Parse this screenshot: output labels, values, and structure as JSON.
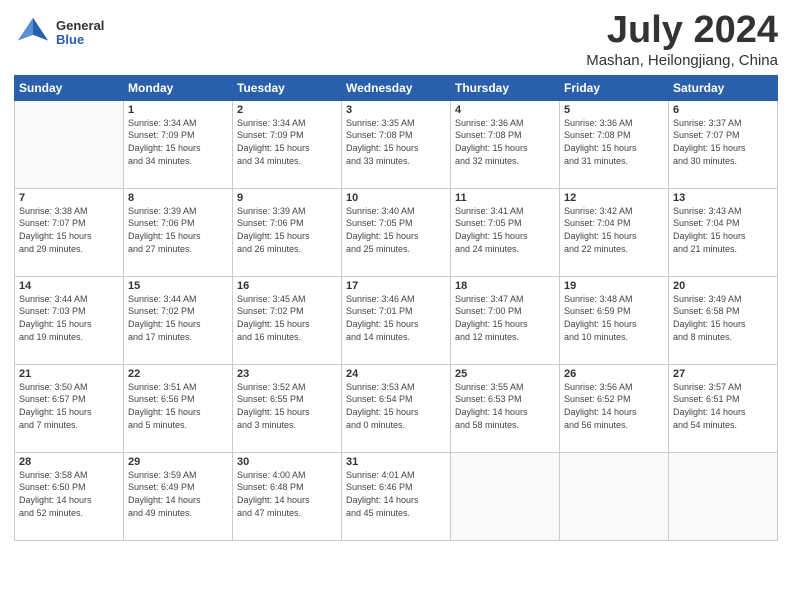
{
  "logo": {
    "general": "General",
    "blue": "Blue"
  },
  "title": "July 2024",
  "location": "Mashan, Heilongjiang, China",
  "days_of_week": [
    "Sunday",
    "Monday",
    "Tuesday",
    "Wednesday",
    "Thursday",
    "Friday",
    "Saturday"
  ],
  "weeks": [
    [
      {
        "day": "",
        "info": ""
      },
      {
        "day": "1",
        "info": "Sunrise: 3:34 AM\nSunset: 7:09 PM\nDaylight: 15 hours\nand 34 minutes."
      },
      {
        "day": "2",
        "info": "Sunrise: 3:34 AM\nSunset: 7:09 PM\nDaylight: 15 hours\nand 34 minutes."
      },
      {
        "day": "3",
        "info": "Sunrise: 3:35 AM\nSunset: 7:08 PM\nDaylight: 15 hours\nand 33 minutes."
      },
      {
        "day": "4",
        "info": "Sunrise: 3:36 AM\nSunset: 7:08 PM\nDaylight: 15 hours\nand 32 minutes."
      },
      {
        "day": "5",
        "info": "Sunrise: 3:36 AM\nSunset: 7:08 PM\nDaylight: 15 hours\nand 31 minutes."
      },
      {
        "day": "6",
        "info": "Sunrise: 3:37 AM\nSunset: 7:07 PM\nDaylight: 15 hours\nand 30 minutes."
      }
    ],
    [
      {
        "day": "7",
        "info": "Sunrise: 3:38 AM\nSunset: 7:07 PM\nDaylight: 15 hours\nand 29 minutes."
      },
      {
        "day": "8",
        "info": "Sunrise: 3:39 AM\nSunset: 7:06 PM\nDaylight: 15 hours\nand 27 minutes."
      },
      {
        "day": "9",
        "info": "Sunrise: 3:39 AM\nSunset: 7:06 PM\nDaylight: 15 hours\nand 26 minutes."
      },
      {
        "day": "10",
        "info": "Sunrise: 3:40 AM\nSunset: 7:05 PM\nDaylight: 15 hours\nand 25 minutes."
      },
      {
        "day": "11",
        "info": "Sunrise: 3:41 AM\nSunset: 7:05 PM\nDaylight: 15 hours\nand 24 minutes."
      },
      {
        "day": "12",
        "info": "Sunrise: 3:42 AM\nSunset: 7:04 PM\nDaylight: 15 hours\nand 22 minutes."
      },
      {
        "day": "13",
        "info": "Sunrise: 3:43 AM\nSunset: 7:04 PM\nDaylight: 15 hours\nand 21 minutes."
      }
    ],
    [
      {
        "day": "14",
        "info": "Sunrise: 3:44 AM\nSunset: 7:03 PM\nDaylight: 15 hours\nand 19 minutes."
      },
      {
        "day": "15",
        "info": "Sunrise: 3:44 AM\nSunset: 7:02 PM\nDaylight: 15 hours\nand 17 minutes."
      },
      {
        "day": "16",
        "info": "Sunrise: 3:45 AM\nSunset: 7:02 PM\nDaylight: 15 hours\nand 16 minutes."
      },
      {
        "day": "17",
        "info": "Sunrise: 3:46 AM\nSunset: 7:01 PM\nDaylight: 15 hours\nand 14 minutes."
      },
      {
        "day": "18",
        "info": "Sunrise: 3:47 AM\nSunset: 7:00 PM\nDaylight: 15 hours\nand 12 minutes."
      },
      {
        "day": "19",
        "info": "Sunrise: 3:48 AM\nSunset: 6:59 PM\nDaylight: 15 hours\nand 10 minutes."
      },
      {
        "day": "20",
        "info": "Sunrise: 3:49 AM\nSunset: 6:58 PM\nDaylight: 15 hours\nand 8 minutes."
      }
    ],
    [
      {
        "day": "21",
        "info": "Sunrise: 3:50 AM\nSunset: 6:57 PM\nDaylight: 15 hours\nand 7 minutes."
      },
      {
        "day": "22",
        "info": "Sunrise: 3:51 AM\nSunset: 6:56 PM\nDaylight: 15 hours\nand 5 minutes."
      },
      {
        "day": "23",
        "info": "Sunrise: 3:52 AM\nSunset: 6:55 PM\nDaylight: 15 hours\nand 3 minutes."
      },
      {
        "day": "24",
        "info": "Sunrise: 3:53 AM\nSunset: 6:54 PM\nDaylight: 15 hours\nand 0 minutes."
      },
      {
        "day": "25",
        "info": "Sunrise: 3:55 AM\nSunset: 6:53 PM\nDaylight: 14 hours\nand 58 minutes."
      },
      {
        "day": "26",
        "info": "Sunrise: 3:56 AM\nSunset: 6:52 PM\nDaylight: 14 hours\nand 56 minutes."
      },
      {
        "day": "27",
        "info": "Sunrise: 3:57 AM\nSunset: 6:51 PM\nDaylight: 14 hours\nand 54 minutes."
      }
    ],
    [
      {
        "day": "28",
        "info": "Sunrise: 3:58 AM\nSunset: 6:50 PM\nDaylight: 14 hours\nand 52 minutes."
      },
      {
        "day": "29",
        "info": "Sunrise: 3:59 AM\nSunset: 6:49 PM\nDaylight: 14 hours\nand 49 minutes."
      },
      {
        "day": "30",
        "info": "Sunrise: 4:00 AM\nSunset: 6:48 PM\nDaylight: 14 hours\nand 47 minutes."
      },
      {
        "day": "31",
        "info": "Sunrise: 4:01 AM\nSunset: 6:46 PM\nDaylight: 14 hours\nand 45 minutes."
      },
      {
        "day": "",
        "info": ""
      },
      {
        "day": "",
        "info": ""
      },
      {
        "day": "",
        "info": ""
      }
    ]
  ]
}
